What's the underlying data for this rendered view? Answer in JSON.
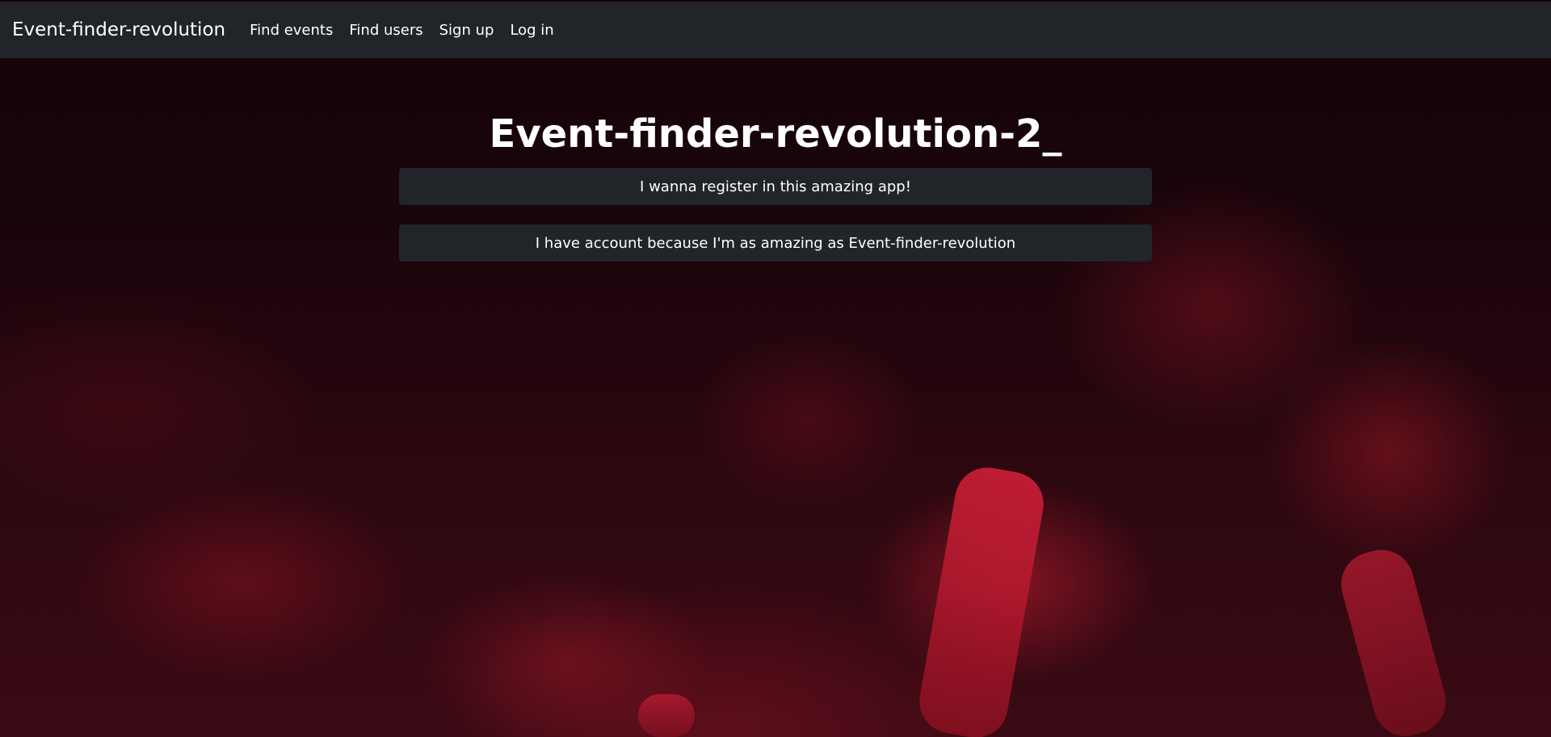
{
  "navbar": {
    "brand": "Event-finder-revolution",
    "links": [
      "Find events",
      "Find users",
      "Sign up",
      "Log in"
    ]
  },
  "main": {
    "title": "Event-finder-revolution-2_",
    "register_button": "I wanna register in this amazing app!",
    "login_button": "I have account because I'm as amazing as Event-finder-revolution"
  },
  "colors": {
    "navbar_bg": "#212529",
    "button_bg": "#212529",
    "text": "#ffffff",
    "background_tint": "#3a0a14"
  }
}
